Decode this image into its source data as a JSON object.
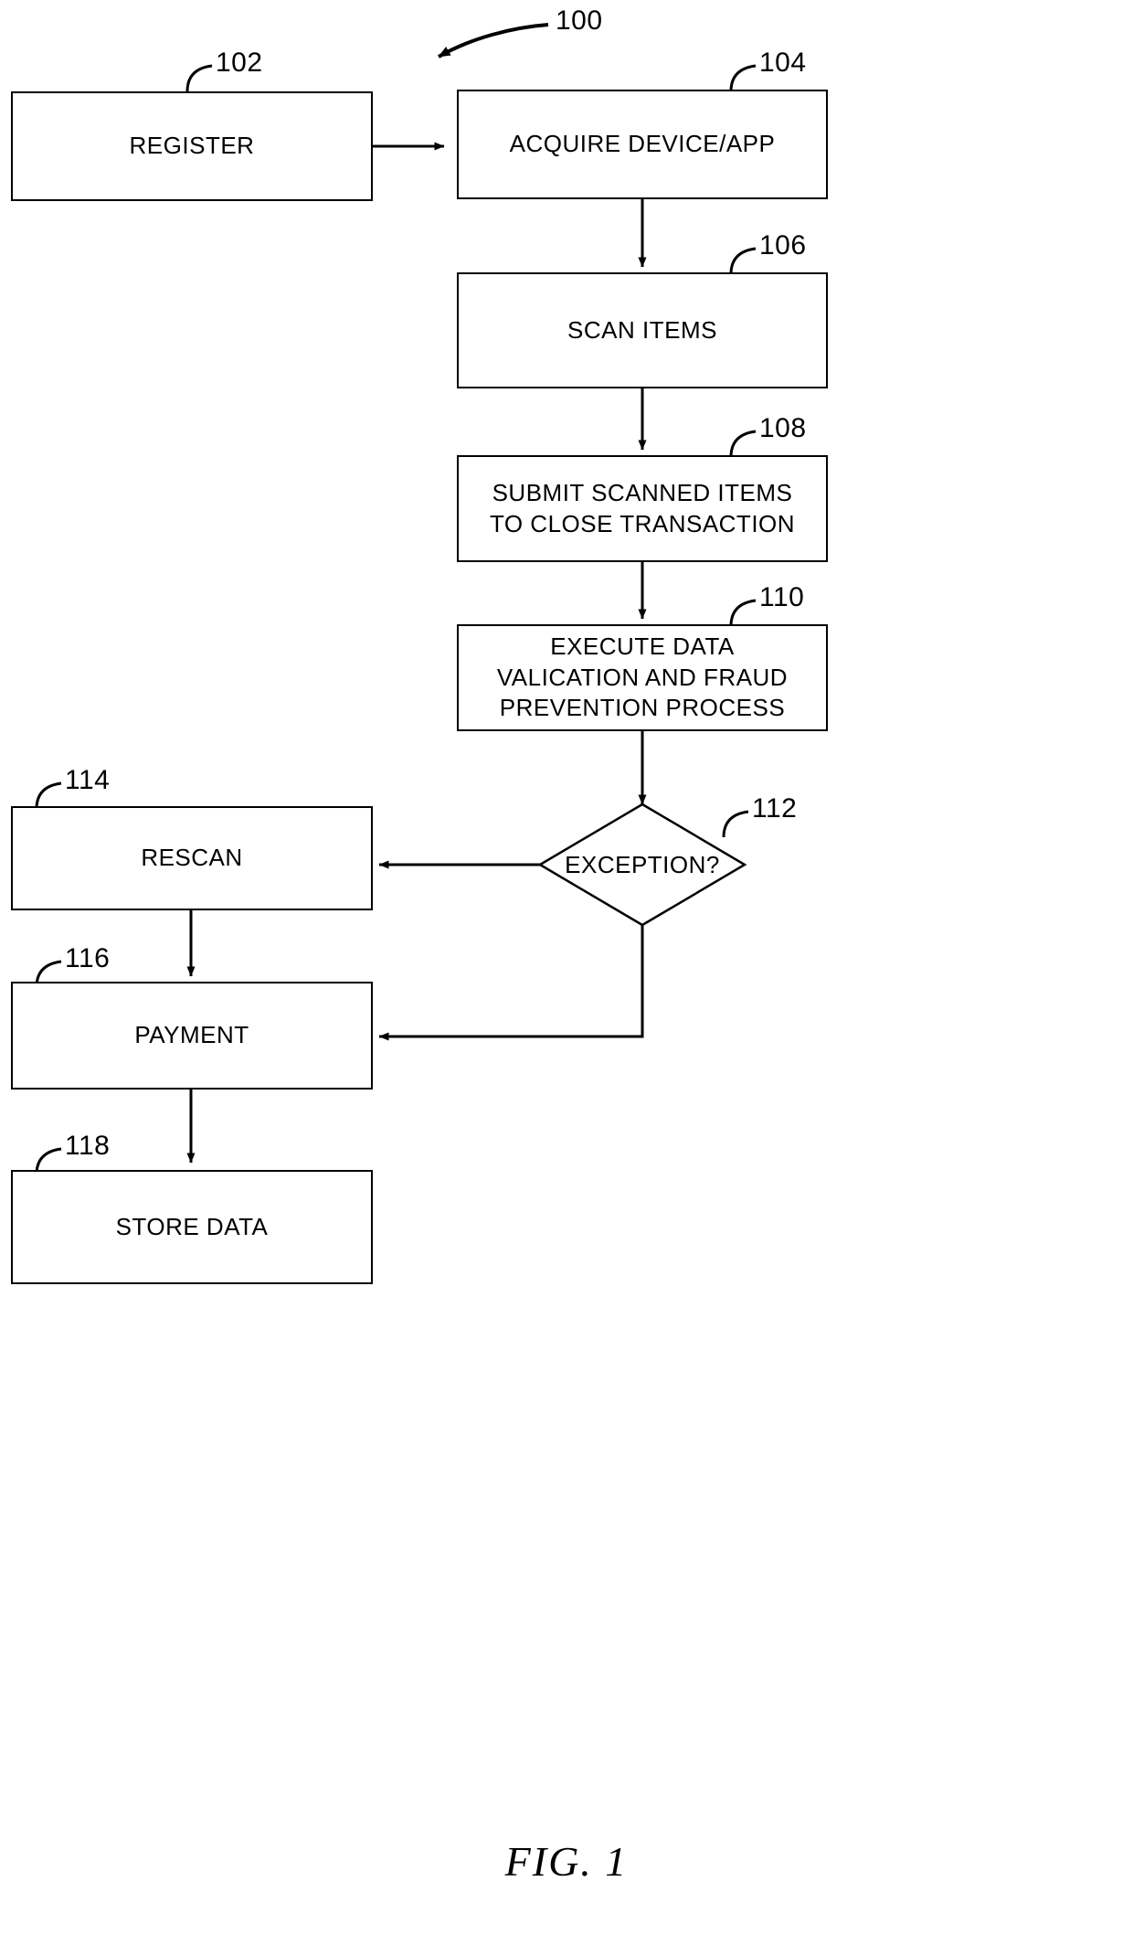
{
  "figure": {
    "caption": "FIG. 1",
    "overall_ref": "100"
  },
  "nodes": [
    {
      "ref": "102",
      "shape": "process",
      "label": "REGISTER",
      "name": "node-register"
    },
    {
      "ref": "104",
      "shape": "process",
      "label": "ACQUIRE DEVICE/APP",
      "name": "node-acquire-device-app"
    },
    {
      "ref": "106",
      "shape": "process",
      "label": "SCAN ITEMS",
      "name": "node-scan-items"
    },
    {
      "ref": "108",
      "shape": "process",
      "label": "SUBMIT SCANNED ITEMS\nTO CLOSE TRANSACTION",
      "name": "node-submit-scanned-items"
    },
    {
      "ref": "110",
      "shape": "process",
      "label": "EXECUTE DATA\nVALICATION AND FRAUD\nPREVENTION PROCESS",
      "name": "node-execute-data-valication"
    },
    {
      "ref": "112",
      "shape": "decision",
      "label": "EXCEPTION?",
      "name": "node-exception-decision"
    },
    {
      "ref": "114",
      "shape": "process",
      "label": "RESCAN",
      "name": "node-rescan"
    },
    {
      "ref": "116",
      "shape": "process",
      "label": "PAYMENT",
      "name": "node-payment"
    },
    {
      "ref": "118",
      "shape": "process",
      "label": "STORE DATA",
      "name": "node-store-data"
    }
  ],
  "connectors": [
    {
      "from": "102",
      "to": "104",
      "direction": "right"
    },
    {
      "from": "104",
      "to": "106",
      "direction": "down"
    },
    {
      "from": "106",
      "to": "108",
      "direction": "down"
    },
    {
      "from": "108",
      "to": "110",
      "direction": "down"
    },
    {
      "from": "110",
      "to": "112",
      "direction": "down"
    },
    {
      "from": "112",
      "to": "114",
      "direction": "left"
    },
    {
      "from": "112",
      "to": "116",
      "direction": "down-left"
    },
    {
      "from": "114",
      "to": "116",
      "direction": "down"
    },
    {
      "from": "116",
      "to": "118",
      "direction": "down"
    }
  ],
  "colors": {
    "stroke": "#000000",
    "fill": "#ffffff",
    "text": "#000000"
  }
}
